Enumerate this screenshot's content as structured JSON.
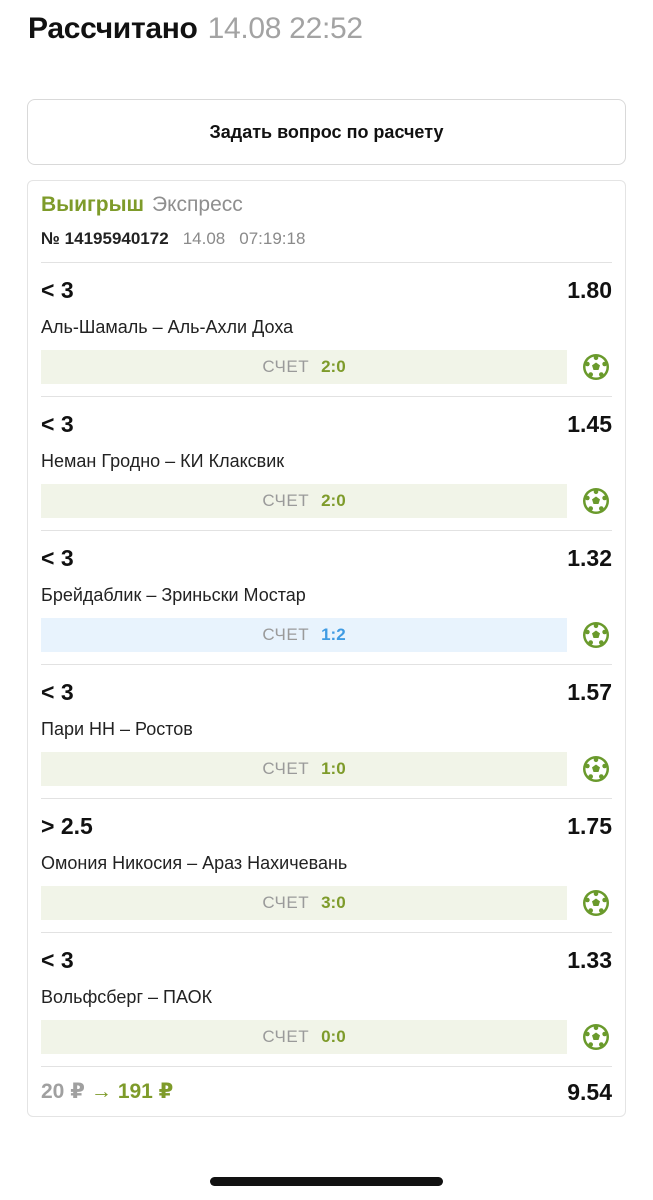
{
  "header": {
    "title": "Рассчитано",
    "datetime": "14.08 22:52"
  },
  "ask_button": {
    "label": "Задать вопрос по расчету"
  },
  "bet": {
    "result": "Выигрыш",
    "type": "Экспресс",
    "number": "№ 14195940172",
    "date": "14.08",
    "time": "07:19:18",
    "score_label": "СЧЕТ",
    "events": [
      {
        "market": "< 3",
        "odds": "1.80",
        "teams": "Аль-Шамаль – Аль-Ахли Доха",
        "score": "2:0",
        "highlight": "green",
        "sport_icon": "football-icon"
      },
      {
        "market": "< 3",
        "odds": "1.45",
        "teams": "Неман Гродно – КИ Клаксвик",
        "score": "2:0",
        "highlight": "green",
        "sport_icon": "football-icon"
      },
      {
        "market": "< 3",
        "odds": "1.32",
        "teams": "Брейдаблик – Зриньски Мостар",
        "score": "1:2",
        "highlight": "blue",
        "sport_icon": "football-icon"
      },
      {
        "market": "< 3",
        "odds": "1.57",
        "teams": "Пари НН – Ростов",
        "score": "1:0",
        "highlight": "green",
        "sport_icon": "football-icon"
      },
      {
        "market": "> 2.5",
        "odds": "1.75",
        "teams": "Омония Никосия – Араз Нахичевань",
        "score": "3:0",
        "highlight": "green",
        "sport_icon": "football-icon"
      },
      {
        "market": "< 3",
        "odds": "1.33",
        "teams": "Вольфсберг – ПАОК",
        "score": "0:0",
        "highlight": "green",
        "sport_icon": "football-icon"
      }
    ],
    "stake": "20 ₽",
    "arrow": "→",
    "payout": "191 ₽",
    "total_odds": "9.54"
  },
  "colors": {
    "win": "#7e9b2a",
    "muted": "#a3a3a3",
    "score_green_bg": "#f1f4e8",
    "score_blue_bg": "#e8f3fd",
    "score_blue_text": "#3f9be3",
    "ball": "#6a9a2c"
  }
}
